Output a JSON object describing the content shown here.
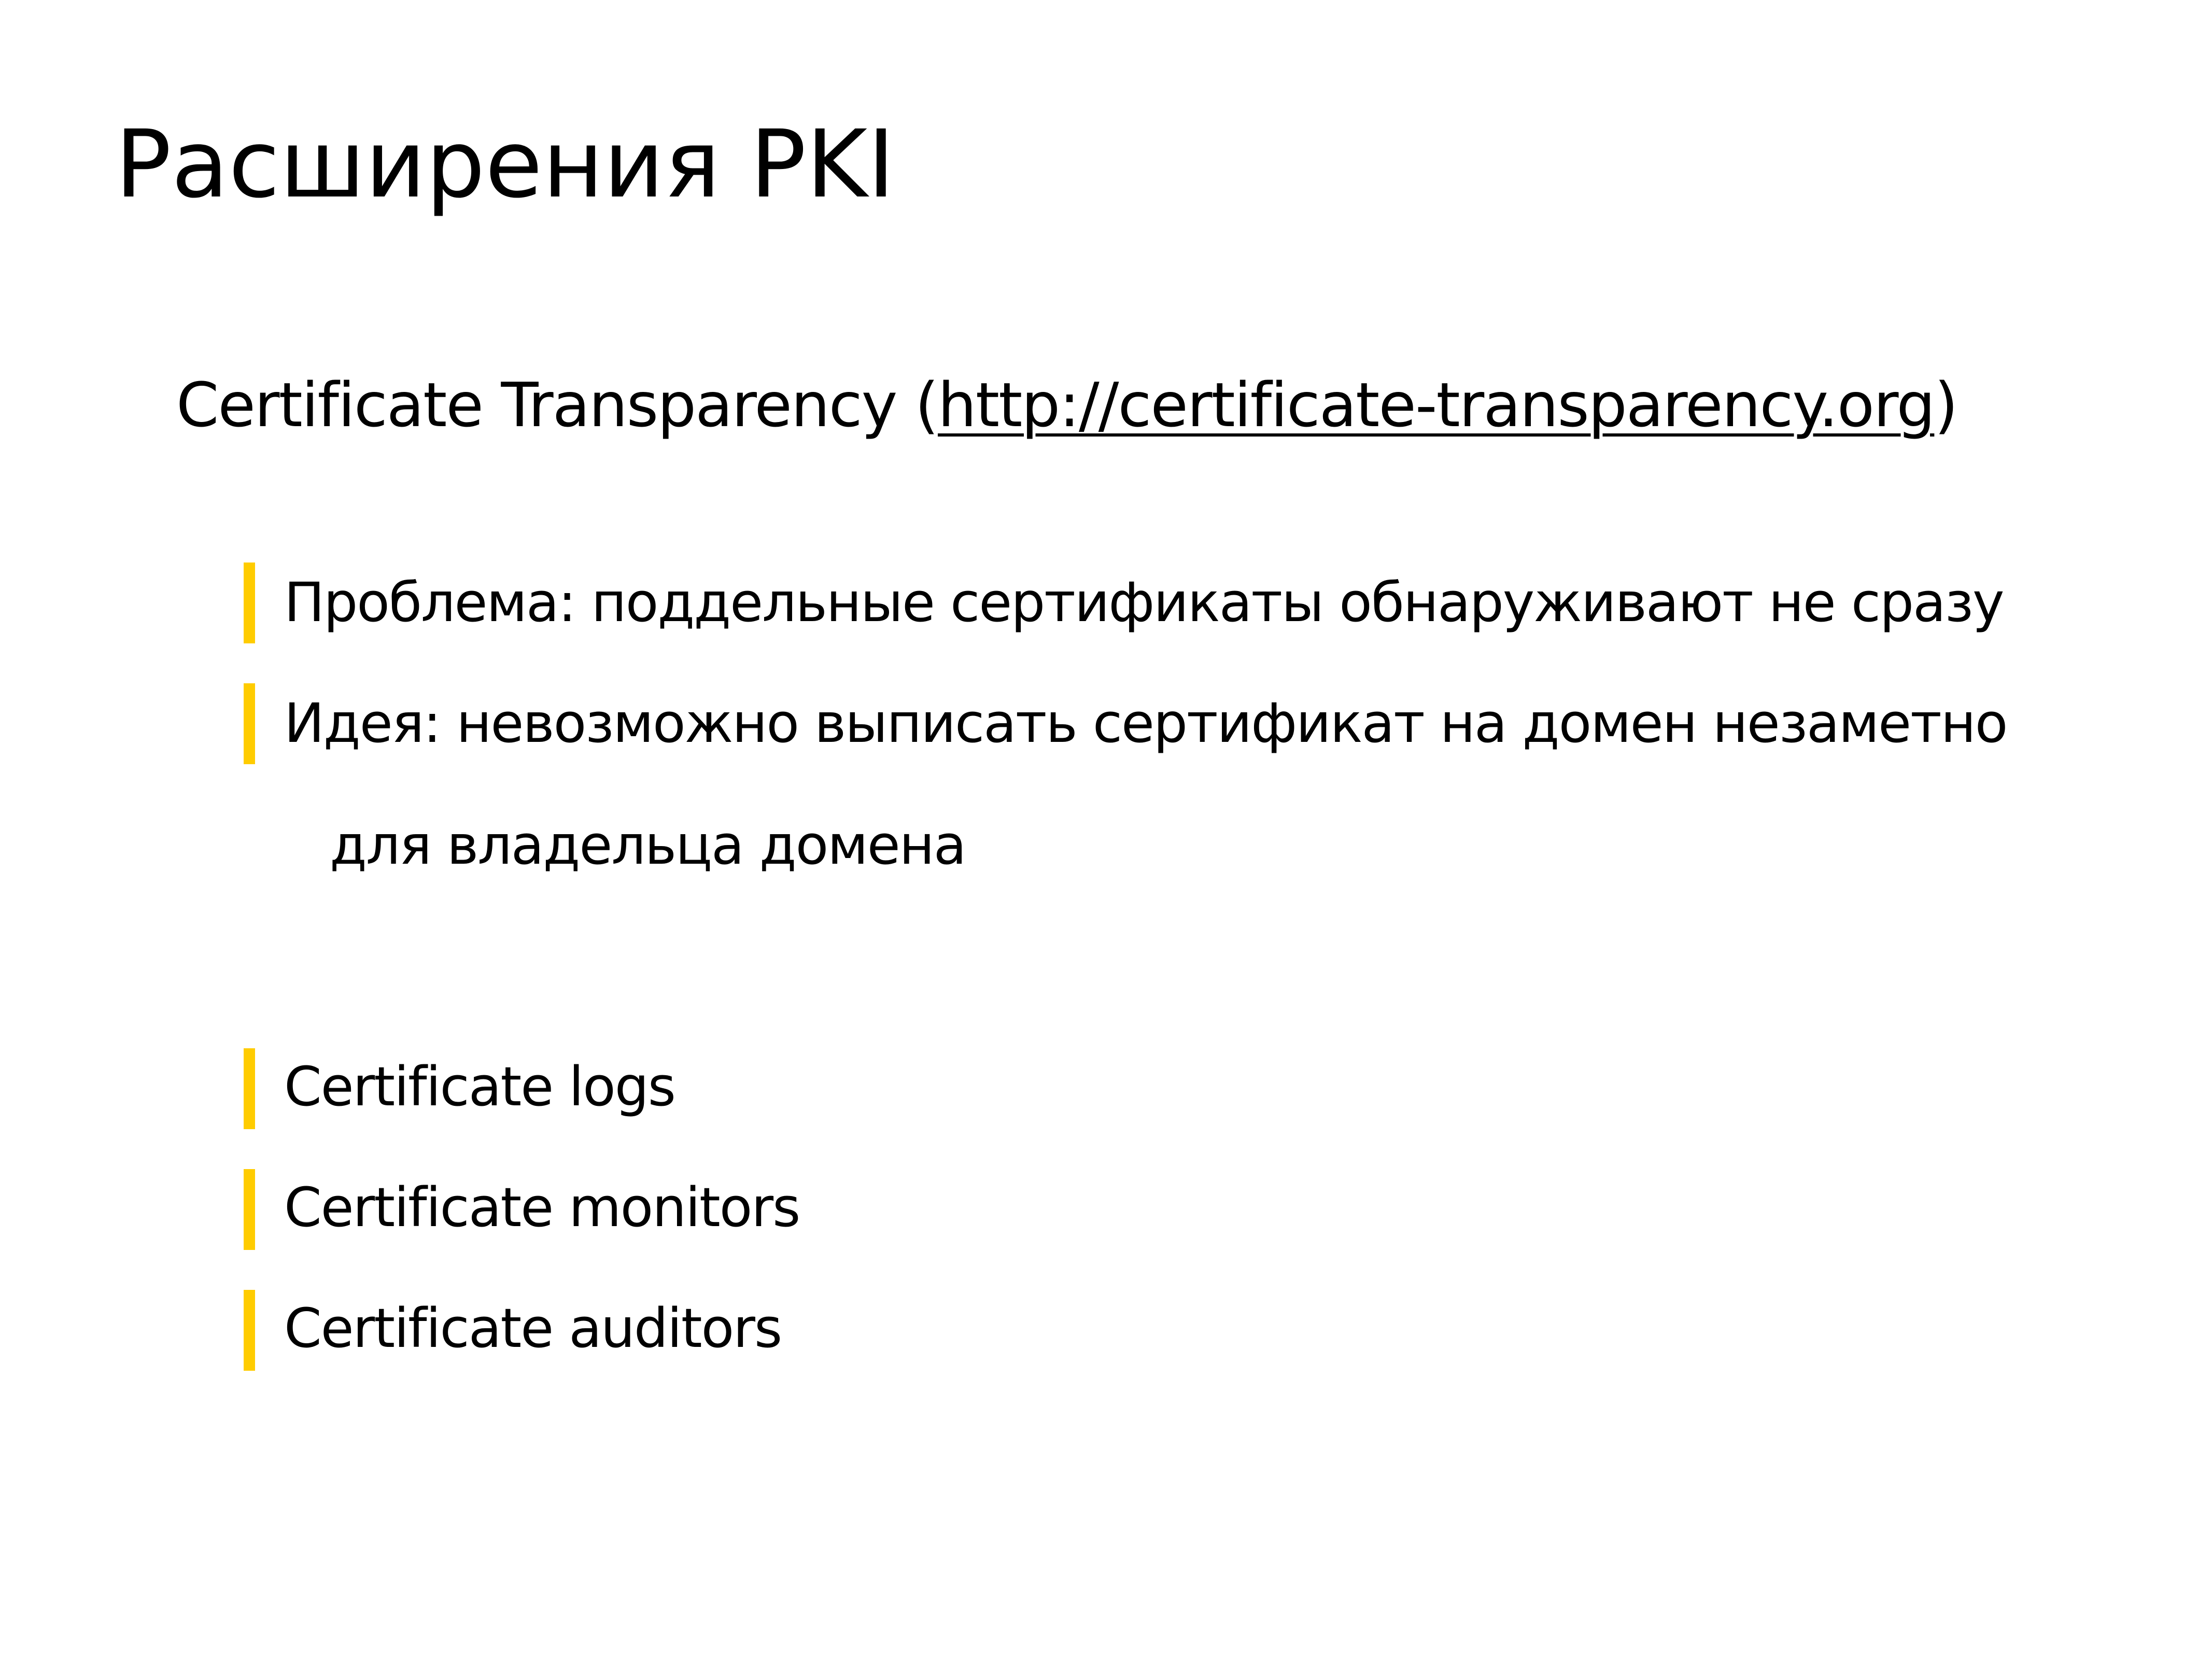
{
  "slide": {
    "title": "Расширения PKI",
    "subtitle_prefix": "Certificate Transparency (",
    "subtitle_link": "http://certificate-transparency.org",
    "subtitle_suffix": ")",
    "accent_color": "#ffcc00",
    "bullets_group1": [
      {
        "text": "Проблема: поддельные сертификаты обнаруживают не сразу"
      },
      {
        "text": "Идея: невозможно выписать сертификат на домен незаметно",
        "continuation": "для владельца домена"
      }
    ],
    "bullets_group2": [
      {
        "text": "Certificate logs"
      },
      {
        "text": "Certificate monitors"
      },
      {
        "text": "Certificate auditors"
      }
    ]
  }
}
